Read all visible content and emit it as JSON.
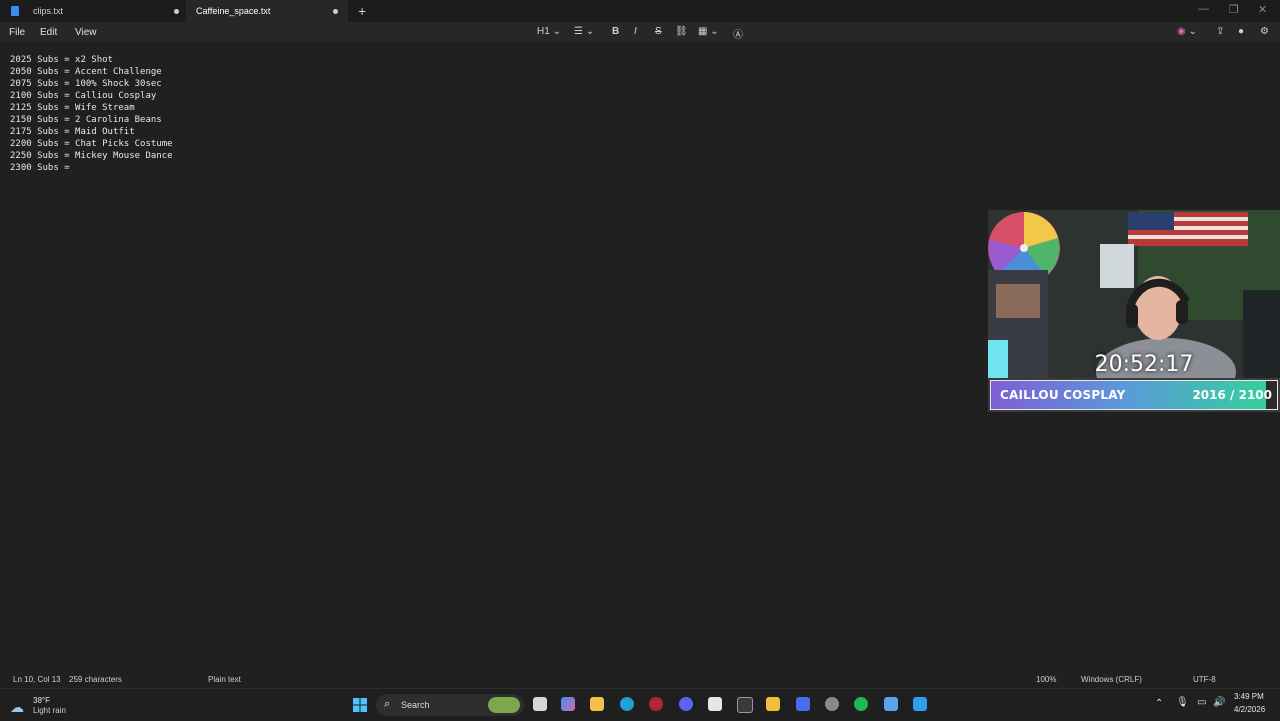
{
  "tabs": [
    {
      "label": "clips.txt",
      "modified": true,
      "active": false
    },
    {
      "label": "Caffeine_space.txt",
      "modified": true,
      "active": true
    }
  ],
  "menu": [
    "File",
    "Edit",
    "View"
  ],
  "toolbar": {
    "heading": "H1"
  },
  "document": {
    "lines": [
      "2025 Subs = x2 Shot",
      "2050 Subs = Accent Challenge",
      "2075 Subs = 100% Shock 30sec",
      "2100 Subs = Calliou Cosplay",
      "2125 Subs = Wife Stream",
      "2150 Subs = 2 Carolina Beans",
      "2175 Subs = Maid Outfit",
      "2200 Subs = Chat Picks Costume",
      "2250 Subs = Mickey Mouse Dance",
      "2300 Subs = "
    ]
  },
  "overlay": {
    "timer": "20:52:17",
    "goal_label": "CAILLOU COSPLAY",
    "goal_count": "2016 / 2100",
    "goal_progress": 0.96,
    "bar_gradient": [
      "#7e5fd6",
      "#5a9bd8",
      "#34d09b"
    ]
  },
  "status": {
    "position": "Ln 10, Col 13",
    "characters": "259 characters",
    "format": "Plain text",
    "zoom": "100%",
    "line_ending": "Windows (CRLF)",
    "encoding": "UTF-8"
  },
  "taskbar": {
    "weather_temp": "38°F",
    "weather_desc": "Light rain",
    "search_label": "Search",
    "time": "3:49 PM",
    "date": "4/2/2026"
  },
  "colors": {
    "accent": "#3b8ef0",
    "background": "#202020"
  }
}
